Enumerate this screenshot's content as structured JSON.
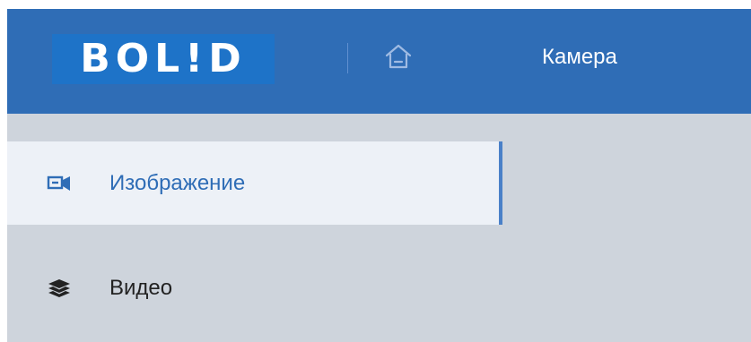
{
  "header": {
    "logo_text": "BOL!D",
    "home_icon": "home-icon",
    "title": "Камера"
  },
  "sidebar": {
    "items": [
      {
        "label": "Изображение",
        "icon": "camera-icon",
        "active": true
      },
      {
        "label": "Видео",
        "icon": "layers-icon",
        "active": false
      }
    ]
  },
  "colors": {
    "header_bg": "#2f6db6",
    "logo_bg": "#1e73c8",
    "content_bg": "#ced4dc",
    "active_item_bg": "#edf1f7",
    "accent": "#4a80c8"
  }
}
